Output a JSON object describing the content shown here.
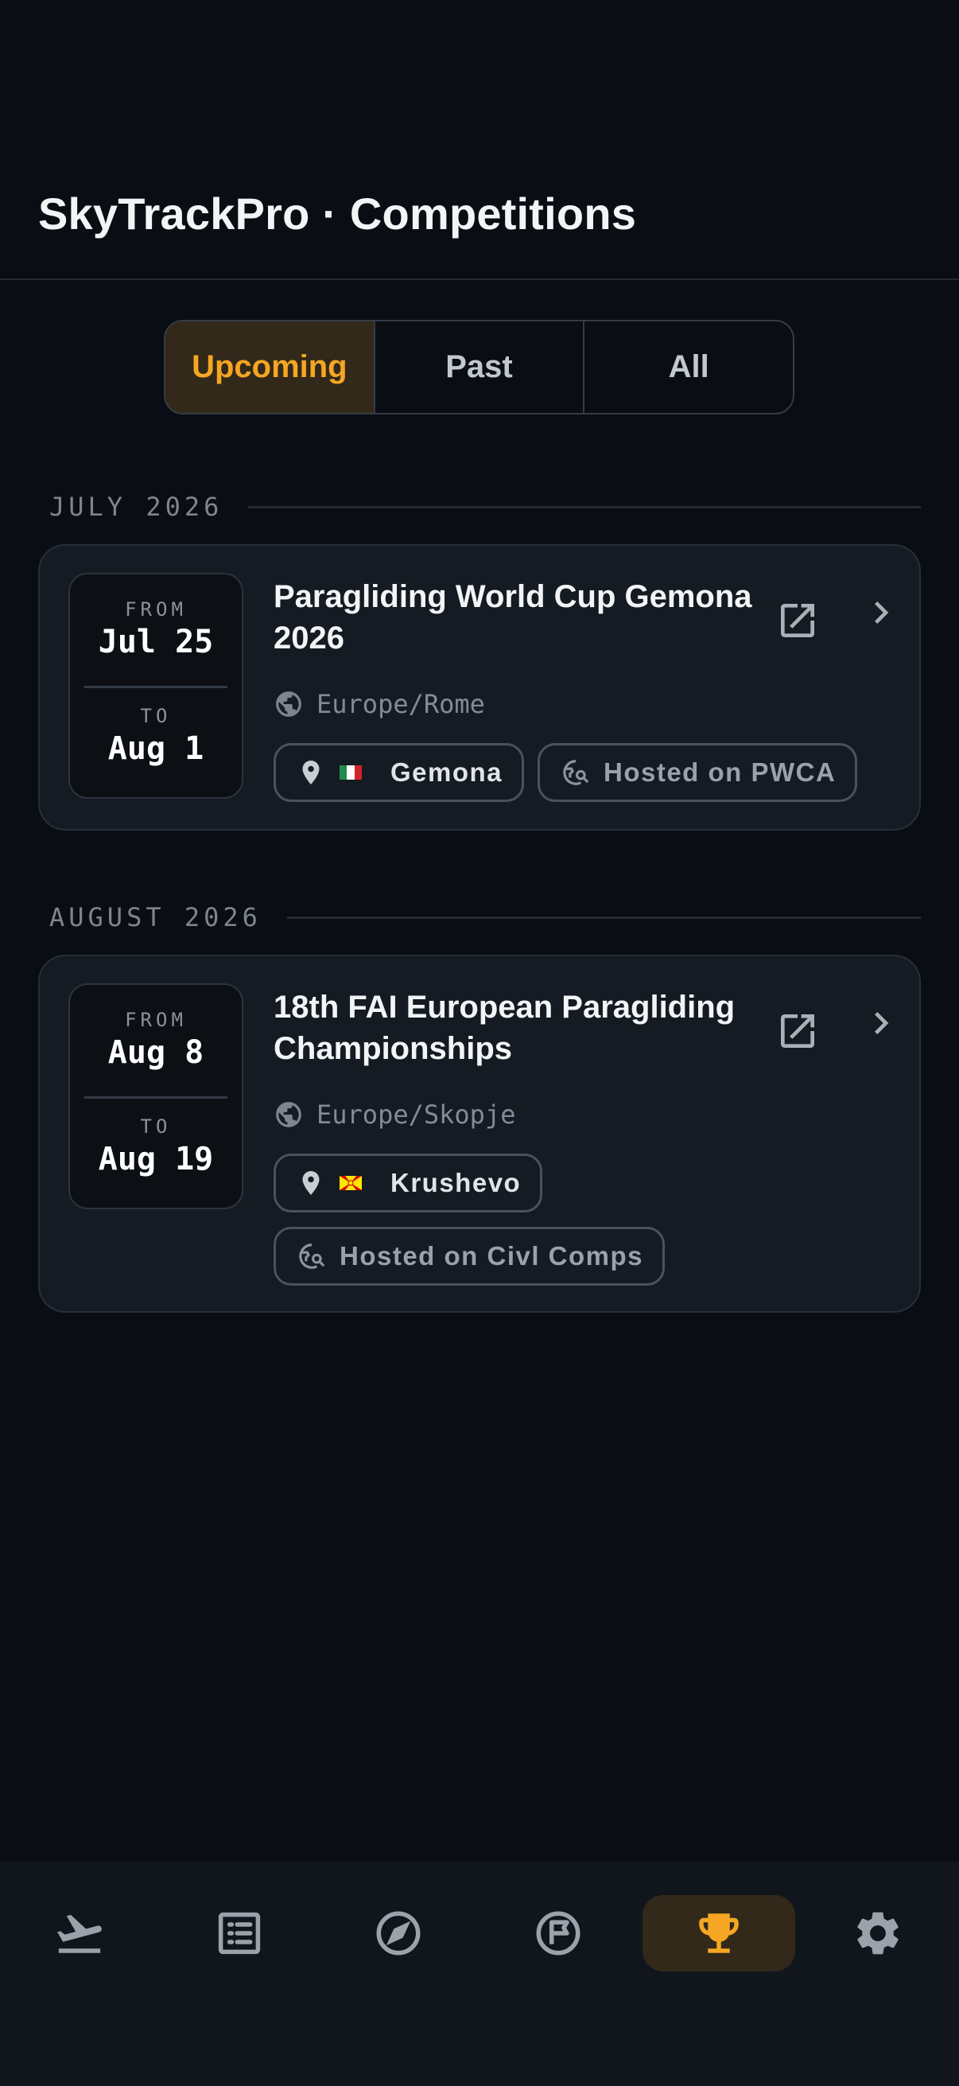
{
  "header": {
    "title": "SkyTrackPro · Competitions"
  },
  "filter": {
    "options": [
      {
        "label": "Upcoming",
        "active": true
      },
      {
        "label": "Past",
        "active": false
      },
      {
        "label": "All",
        "active": false
      }
    ]
  },
  "sections": [
    {
      "month": "JULY 2026",
      "competition": {
        "from_caption": "FROM",
        "from_date": "Jul 25",
        "to_caption": "TO",
        "to_date": "Aug 1",
        "title": "Paragliding World Cup Gemona 2026",
        "timezone": "Europe/Rome",
        "location": "Gemona",
        "flag": "italy-flag-icon",
        "host": "Hosted on PWCA"
      }
    },
    {
      "month": "AUGUST 2026",
      "competition": {
        "from_caption": "FROM",
        "from_date": "Aug 8",
        "to_caption": "TO",
        "to_date": "Aug 19",
        "title": "18th FAI European Paragliding Championships",
        "timezone": "Europe/Skopje",
        "location": "Krushevo",
        "flag": "north-macedonia-flag-icon",
        "host": "Hosted on Civl Comps"
      }
    }
  ],
  "nav": {
    "items": [
      {
        "icon": "flight-takeoff-icon",
        "active": false
      },
      {
        "icon": "list-icon",
        "active": false
      },
      {
        "icon": "compass-icon",
        "active": false
      },
      {
        "icon": "flag-circle-icon",
        "active": false
      },
      {
        "icon": "trophy-icon",
        "active": true
      },
      {
        "icon": "gear-icon",
        "active": false
      }
    ]
  },
  "colors": {
    "background": "#0a0d13",
    "card": "#141b22",
    "accent": "#f5a623",
    "accent_bg": "#33291a",
    "muted_text": "#838b95"
  }
}
